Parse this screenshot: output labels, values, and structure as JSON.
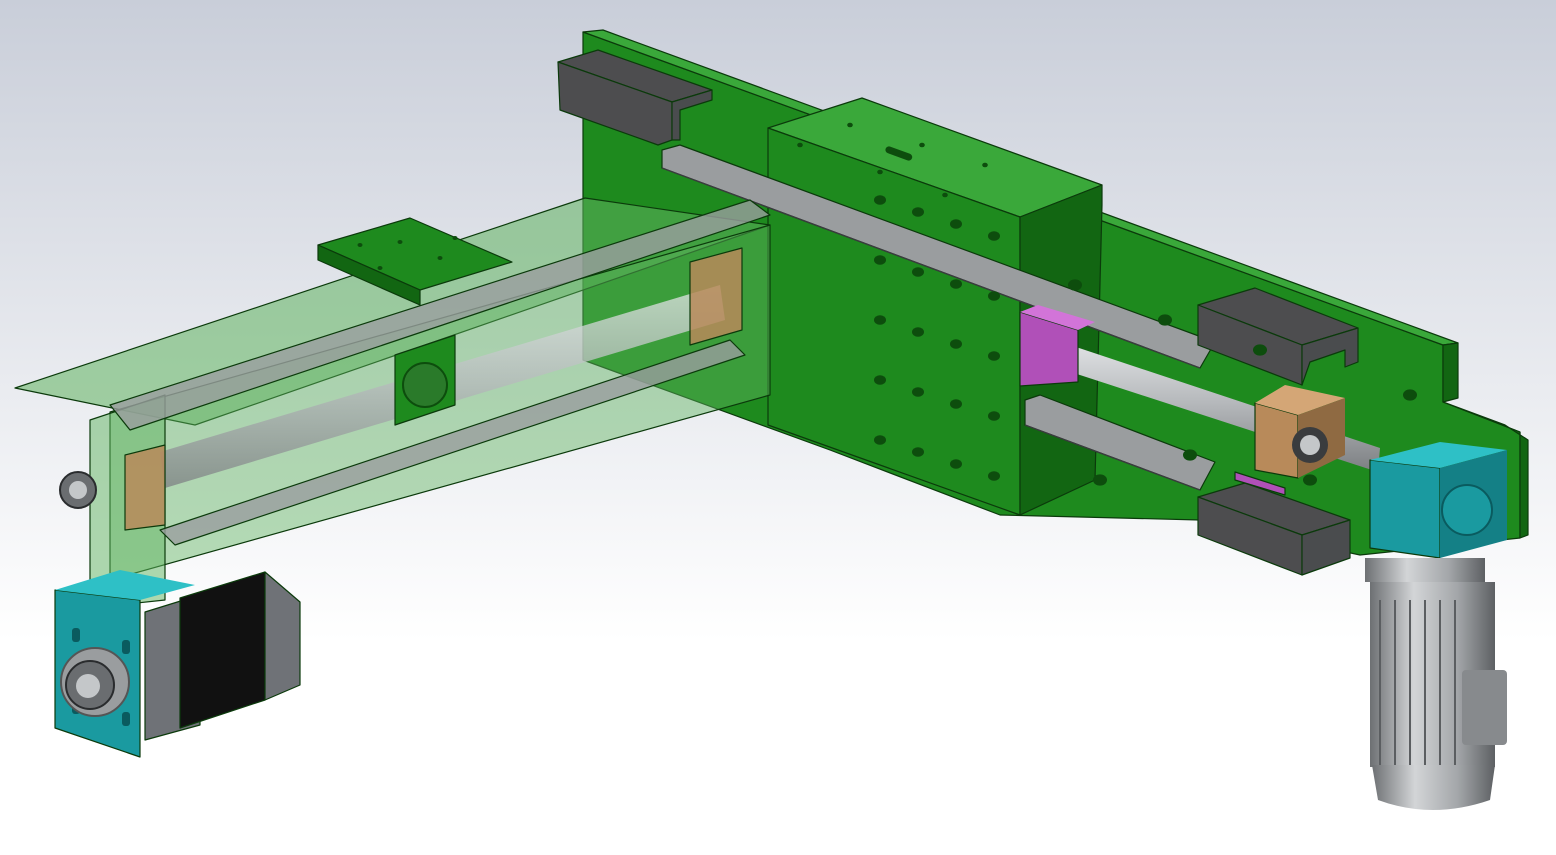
{
  "view": {
    "background_top": "#c9ced9",
    "background_bottom": "#ffffff"
  },
  "colors": {
    "frame_green": "#1e8a1e",
    "frame_green_dark": "#126612",
    "frame_green_light": "#3aa83a",
    "transparent_green": "#5fb35f",
    "rail_steel": "#9a9d9f",
    "rail_dark": "#4a4c4e",
    "ballscrew": "#c4c7c9",
    "bracket_grey": "#4d4d4f",
    "bearing_bronze": "#b88a5a",
    "nut_magenta": "#b050b8",
    "gearbox_teal": "#1a9aa0",
    "motor_grey": "#9da0a3",
    "stepper_black": "#111111",
    "stepper_grey": "#6f7277"
  },
  "parts": [
    {
      "name": "base-plate",
      "color_key": "frame_green"
    },
    {
      "name": "carriage-block",
      "color_key": "frame_green"
    },
    {
      "name": "transparent-arm",
      "color_key": "transparent_green"
    },
    {
      "name": "linear-rail-upper",
      "color_key": "rail_steel"
    },
    {
      "name": "linear-rail-lower",
      "color_key": "rail_steel"
    },
    {
      "name": "ballscrew-shaft",
      "color_key": "ballscrew"
    },
    {
      "name": "ballscrew-nut",
      "color_key": "nut_magenta"
    },
    {
      "name": "bearing-block",
      "color_key": "bearing_bronze"
    },
    {
      "name": "gearbox",
      "color_key": "gearbox_teal"
    },
    {
      "name": "ac-motor",
      "color_key": "motor_grey"
    },
    {
      "name": "stepper-motor",
      "color_key": "stepper_black"
    },
    {
      "name": "motor-mount-plate",
      "color_key": "gearbox_teal"
    },
    {
      "name": "cable-bracket-top-left",
      "color_key": "bracket_grey"
    },
    {
      "name": "cable-bracket-mid-right",
      "color_key": "bracket_grey"
    },
    {
      "name": "cable-bracket-bottom-right",
      "color_key": "bracket_grey"
    }
  ]
}
